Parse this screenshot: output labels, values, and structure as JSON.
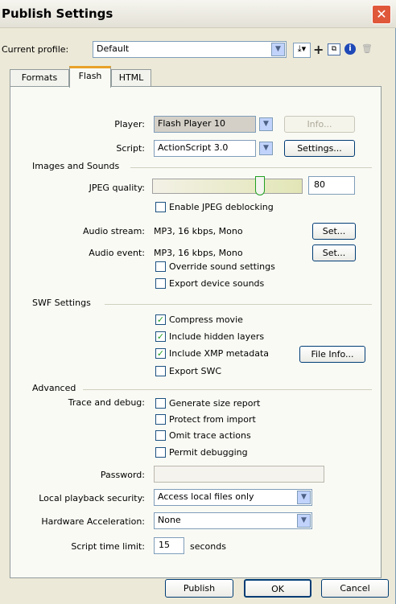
{
  "window": {
    "title": "Publish Settings"
  },
  "profile": {
    "label": "Current profile:",
    "value": "Default"
  },
  "tabs": [
    {
      "label": "Formats"
    },
    {
      "label": "Flash"
    },
    {
      "label": "HTML"
    }
  ],
  "player": {
    "label": "Player:",
    "value": "Flash Player 10",
    "info_label": "Info..."
  },
  "script": {
    "label": "Script:",
    "value": "ActionScript 3.0",
    "settings_label": "Settings..."
  },
  "images_sounds": {
    "header": "Images and Sounds",
    "jpeg_quality_label": "JPEG quality:",
    "jpeg_quality_value": "80",
    "jpeg_quality": 0.8,
    "deblocking_label": "Enable JPEG deblocking",
    "audio_stream_label": "Audio stream:",
    "audio_stream_value": "MP3, 16 kbps, Mono",
    "audio_event_label": "Audio event:",
    "audio_event_value": "MP3, 16 kbps, Mono",
    "set_label": "Set...",
    "override_label": "Override sound settings",
    "export_device_label": "Export device sounds"
  },
  "swf": {
    "header": "SWF Settings",
    "compress_label": "Compress movie",
    "hidden_layers_label": "Include hidden layers",
    "xmp_label": "Include XMP metadata",
    "file_info_label": "File Info...",
    "export_swc_label": "Export SWC"
  },
  "advanced": {
    "header": "Advanced",
    "trace_label": "Trace and debug:",
    "size_report_label": "Generate size report",
    "protect_label": "Protect from import",
    "omit_trace_label": "Omit trace actions",
    "permit_debug_label": "Permit debugging",
    "password_label": "Password:",
    "local_security_label": "Local playback security:",
    "local_security_value": "Access local files only",
    "hw_accel_label": "Hardware Acceleration:",
    "hw_accel_value": "None",
    "time_limit_label": "Script time limit:",
    "time_limit_value": "15",
    "time_limit_unit": "seconds"
  },
  "footer": {
    "publish_label": "Publish",
    "ok_label": "OK",
    "cancel_label": "Cancel"
  }
}
